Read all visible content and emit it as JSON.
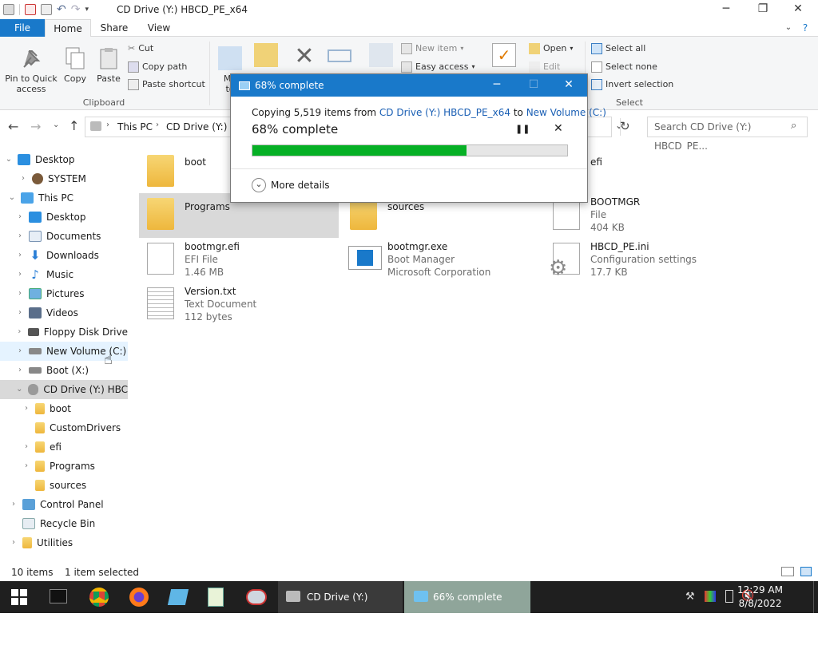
{
  "window": {
    "title": "CD Drive (Y:) HBCD_PE_x64",
    "minimize_glyph": "─",
    "restore_glyph": "❐",
    "close_glyph": "✕"
  },
  "ribbon_tabs": [
    "File",
    "Home",
    "Share",
    "View"
  ],
  "ribbon": {
    "pin_label_1": "Pin to Quick",
    "pin_label_2": "access",
    "copy_label": "Copy",
    "paste_label": "Paste",
    "cut_label": "Cut",
    "copy_path_label": "Copy path",
    "paste_shortcut_label": "Paste shortcut",
    "clipboard_group": "Clipboard",
    "move_to_partial": "Mo",
    "move_to_partial2": "to",
    "new_item_label": "New item",
    "easy_access_label": "Easy access",
    "open_label": "Open",
    "edit_label": "Edit",
    "select_all_label": "Select all",
    "select_none_label": "Select none",
    "invert_selection_label": "Invert selection",
    "select_group": "Select"
  },
  "address": {
    "path": [
      "This PC",
      "CD Drive (Y:) H"
    ],
    "search_placeholder": "Search CD Drive (Y:) HBCD_PE..."
  },
  "nav": {
    "items": [
      {
        "label": "Desktop",
        "icon": "desktop-icon"
      },
      {
        "label": "SYSTEM",
        "icon": "user-icon"
      },
      {
        "label": "This PC",
        "icon": "computer-icon"
      },
      {
        "label": "Desktop",
        "icon": "desktop-icon"
      },
      {
        "label": "Documents",
        "icon": "documents-icon"
      },
      {
        "label": "Downloads",
        "icon": "downloads-icon"
      },
      {
        "label": "Music",
        "icon": "music-icon"
      },
      {
        "label": "Pictures",
        "icon": "pictures-icon"
      },
      {
        "label": "Videos",
        "icon": "videos-icon"
      },
      {
        "label": "Floppy Disk Drive",
        "icon": "floppy-icon"
      },
      {
        "label": "New Volume (C:)",
        "icon": "drive-icon"
      },
      {
        "label": "Boot (X:)",
        "icon": "drive-icon"
      },
      {
        "label": "CD Drive (Y:) HBC",
        "icon": "cd-drive-icon"
      },
      {
        "label": "boot",
        "icon": "folder-icon"
      },
      {
        "label": "CustomDrivers",
        "icon": "folder-icon"
      },
      {
        "label": "efi",
        "icon": "folder-icon"
      },
      {
        "label": "Programs",
        "icon": "folder-icon"
      },
      {
        "label": "sources",
        "icon": "folder-icon"
      },
      {
        "label": "Control Panel",
        "icon": "control-panel-icon"
      },
      {
        "label": "Recycle Bin",
        "icon": "recycle-bin-icon"
      },
      {
        "label": "Utilities",
        "icon": "folder-icon"
      }
    ]
  },
  "files": [
    {
      "name": "boot",
      "type": "",
      "detail": ""
    },
    {
      "name": "efi",
      "type": "",
      "detail": ""
    },
    {
      "name": "Programs",
      "type": "",
      "detail": ""
    },
    {
      "name": "sources",
      "type": "",
      "detail": ""
    },
    {
      "name": "BOOTMGR",
      "type": "File",
      "detail": "404 KB"
    },
    {
      "name": "bootmgr.efi",
      "type": "EFI File",
      "detail": "1.46 MB"
    },
    {
      "name": "bootmgr.exe",
      "type": "Boot Manager",
      "detail": "Microsoft Corporation"
    },
    {
      "name": "HBCD_PE.ini",
      "type": "Configuration settings",
      "detail": "17.7 KB"
    },
    {
      "name": "Version.txt",
      "type": "Text Document",
      "detail": "112 bytes"
    }
  ],
  "status": {
    "items_count": "10 items",
    "selected": "1 item selected"
  },
  "dialog": {
    "title": "68% complete",
    "copy_prefix": "Copying 5,519 items from",
    "source": "CD Drive (Y:) HBCD_PE_x64",
    "to_word": "to",
    "destination": "New Volume (C:)",
    "progress_text": "68% complete",
    "progress_value": 0.68,
    "pause_glyph": "❚❚",
    "cancel_glyph": "✕",
    "more_details": "More details",
    "chevron_glyph": "⌄"
  },
  "taskbar": {
    "explorer_task": "CD Drive (Y:) HBCD...",
    "copy_task": "66% complete",
    "time": "12:29 AM",
    "date": "8/8/2022"
  },
  "colors": {
    "accent": "#1979ca",
    "progress": "#06b025",
    "selection": "#cce8ff"
  }
}
